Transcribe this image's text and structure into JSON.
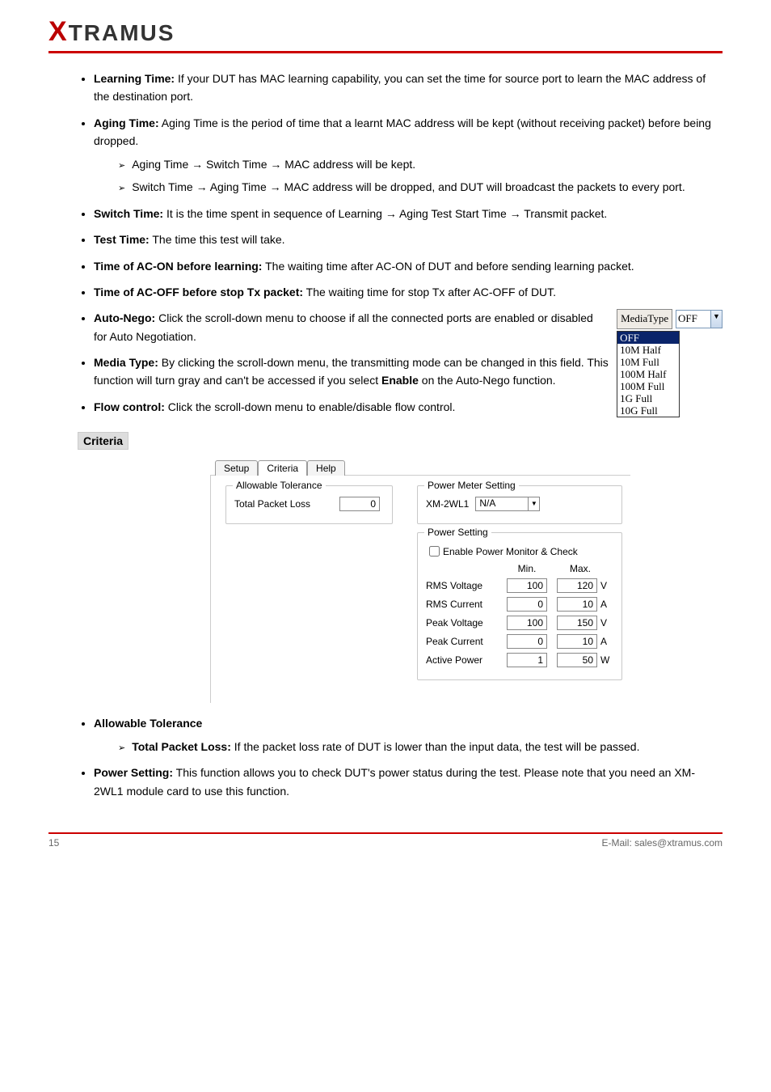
{
  "logo_text": "TRAMUS",
  "bullets": {
    "b1": {
      "label": "Learning Time:",
      "text": " If your DUT has MAC learning capability, you can set the time for source port to learn the MAC address of the destination port."
    },
    "b2": {
      "label": "Aging Time:",
      "text": " Aging Time is the period of time that a learnt MAC address will be kept (without receiving packet) before being dropped.",
      "sub1_pre": "Aging Time ",
      "sub1_mid": " Switch Time ",
      "sub1_post": " MAC address will be kept.",
      "sub2_pre": "Switch Time ",
      "sub2_mid": " Aging Time ",
      "sub2_post": " MAC address will be dropped, and DUT will broadcast the packets to every port."
    },
    "b3": {
      "label": "Switch Time:",
      "text": " It is the time spent in sequence of Learning",
      "mid": "Aging Test Start Time",
      "post": "Transmit packet."
    },
    "b4": {
      "label": "Test Time:",
      "text": " The time this test will take."
    },
    "b5": {
      "label": "Time of AC-ON before learning:",
      "text": " The waiting time after AC-ON of DUT and before sending learning packet."
    },
    "b6": {
      "label": "Time of AC-OFF before stop Tx packet:",
      "text": " The waiting time for stop Tx after AC-OFF of DUT."
    },
    "b7": {
      "label": "Auto-Nego:",
      "text": " Click the scroll-down menu to choose if all the connected ports are enabled or disabled for Auto Negotiation."
    },
    "b8": {
      "label": "Media Type:",
      "text": " By clicking the scroll-down menu, the transmitting mode can be changed in this field. This function will turn gray and can't be accessed if you select ",
      "enable": "Enable",
      "tail": " on the Auto-Nego function."
    },
    "b9": {
      "label": "Flow control:",
      "text": " Click the scroll-down menu to enable/disable flow control."
    }
  },
  "criteria_heading": "Criteria",
  "media": {
    "label": "MediaType",
    "selected": "OFF",
    "options": [
      "OFF",
      "10M Half",
      "10M Full",
      "100M Half",
      "100M Full",
      "1G Full",
      "10G Full"
    ]
  },
  "dialog": {
    "tabs": [
      "Setup",
      "Criteria",
      "Help"
    ],
    "active_tab": "Criteria",
    "allow_group": "Allowable Tolerance",
    "total_packet_loss_label": "Total Packet Loss",
    "total_packet_loss_value": "0",
    "pms_group": "Power Meter Setting",
    "pms_label": "XM-2WL1",
    "pms_value": "N/A",
    "ps_group": "Power Setting",
    "ps_check_label": "Enable Power Monitor & Check",
    "min": "Min.",
    "max": "Max.",
    "rows": [
      {
        "label": "RMS Voltage",
        "min": "100",
        "max": "120",
        "unit": "V"
      },
      {
        "label": "RMS Current",
        "min": "0",
        "max": "10",
        "unit": "A"
      },
      {
        "label": "Peak Voltage",
        "min": "100",
        "max": "150",
        "unit": "V"
      },
      {
        "label": "Peak Current",
        "min": "0",
        "max": "10",
        "unit": "A"
      },
      {
        "label": "Active Power",
        "min": "1",
        "max": "50",
        "unit": "W"
      }
    ]
  },
  "lower": {
    "b1": {
      "label": "Allowable Tolerance"
    },
    "sub1": {
      "label": "Total Packet Loss:",
      "text": " If the packet loss rate of DUT is lower than the input data, the test will be passed."
    },
    "b2": {
      "label": "Power Setting:",
      "text": " This function allows you to check DUT's power status during the test. Please note",
      "tail": " that you need an XM-2WL1 module card to use this function."
    }
  },
  "footer": {
    "left": "15",
    "right": "E-Mail: sales@xtramus.com"
  }
}
